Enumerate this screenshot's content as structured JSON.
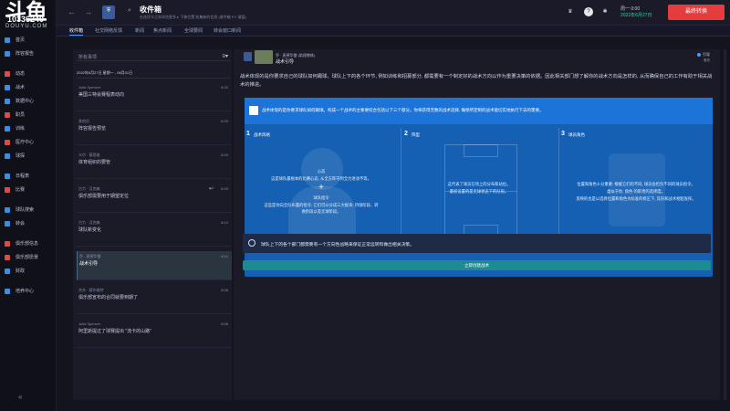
{
  "logo": {
    "mark": "斗鱼",
    "brand": "DOUYU.COM",
    "number": "10336240"
  },
  "sidebar": {
    "items": [
      {
        "label": "首页",
        "color": "#3a8ee6"
      },
      {
        "label": "阵容报告",
        "color": "#3a8ee6"
      },
      {
        "label": "动态",
        "color": "#d94c4c"
      },
      {
        "label": "战术",
        "color": "#3a8ee6"
      },
      {
        "label": "数据中心",
        "color": "#3a8ee6"
      },
      {
        "label": "职员",
        "color": "#d94c4c"
      },
      {
        "label": "训练",
        "color": "#3a8ee6"
      },
      {
        "label": "医疗中心",
        "color": "#d94c4c"
      },
      {
        "label": "球探",
        "color": "#3a8ee6"
      },
      {
        "label": "日程表",
        "color": "#3a8ee6"
      },
      {
        "label": "比赛",
        "color": "#d94c4c"
      },
      {
        "label": "球队搜索",
        "color": "#3a8ee6"
      },
      {
        "label": "转会",
        "color": "#3a8ee6"
      },
      {
        "label": "俱乐部信息",
        "color": "#d94c4c"
      },
      {
        "label": "俱乐部愿景",
        "color": "#d94c4c"
      },
      {
        "label": "财政",
        "color": "#3a8ee6"
      },
      {
        "label": "培养中心",
        "color": "#3a8ee6"
      }
    ],
    "collapse_label": "«"
  },
  "topbar": {
    "back": "←",
    "forward": "→",
    "title": "收件箱",
    "subtitle": "在选项卡之间浏览更多 ▸  下移位置  收集新的信息 (收件箱 PC 键盘)",
    "date_line1": "周一 0:00",
    "date_line2": "2022年6月27日",
    "continue_label": "最终转换"
  },
  "tabs": [
    "收件箱",
    "社交网络反馈",
    "新闻",
    "焦点新闻",
    "全球要闻",
    "转会窗口新闻"
  ],
  "list": {
    "filter_label": "所有事项",
    "filter_icon": "≡▾",
    "period": "2022年6月27日 星期一 - 06月01日",
    "messages": [
      {
        "from": "Julia Spencer",
        "time": "8:20",
        "subject": "美国三特会赛程表动向"
      },
      {
        "from": "其他员",
        "time": "8:20",
        "subject": "阵容报告预览"
      },
      {
        "from": "卡尔 · 基思维",
        "time": "8:20",
        "subject": "体育组织的要管"
      },
      {
        "from": "古力 · 汉克森",
        "time": "8:20",
        "subject": "俱乐部需要用于期望定位"
      },
      {
        "from": "古力 · 汉克森",
        "time": "8:14",
        "subject": "球队新变化"
      },
      {
        "from": "乔 · 麦德华雷",
        "time": "8:14",
        "subject": "战术引导"
      },
      {
        "from": "杰夫 · 赛尔维特",
        "time": "8:08",
        "subject": "俱乐部宣布的合同就要到期了"
      },
      {
        "from": "Julia Spencer",
        "time": "8:08",
        "subject": "阿里斯提过了球赛提出 \"流卡的山路\""
      }
    ]
  },
  "detail": {
    "from": "乔 · 麦德华雷 (助理教练)",
    "subject": "战术引导",
    "toggle_label": "引导",
    "saved_label": "备档",
    "body": "战术体现的是你要求自己的球队如何踢球。球队上下的各个环节, 例如训练和招募部分, 都需要有一个制定好的战术方向以作为重要决策的依据。因此相关部门想了解你的战术方向是怎样的, 从而确保自己的工作有助于相关战术的推进。",
    "banner": "战术体现的是你要求球队如何踢球。构成一个战术的主要要综合包括以下三个部分。你将获得无数的战术选择, 确保所定制的战术能切实地执行下去的需要。",
    "columns": [
      {
        "num": "1",
        "title": "战术风格",
        "text1": "心态",
        "text2": "这是球队最根本的比赛心态, 从全方阵守到全力进攻不等。",
        "plus": "+",
        "text3": "球队指令",
        "text4": "这些是你向全队布置的指令, 它们可以分成三大板块: 持球阶段、转换阶段以及无球阶段。"
      },
      {
        "num": "2",
        "title": "阵型",
        "text1": "这代表了球员在场上的分布和站位。",
        "text2": "最初设置的是无球状态下的队形。"
      },
      {
        "num": "3",
        "title": "球员角色",
        "text1": "位置和角色十分重要; 根据它们的不同, 球员会担负不同的球员指令。",
        "text2": "类似于你, 角色 的职责的选择度。",
        "text3": "反映的也是以选择位置和角色为标准的修正下, 其形和战术相配发挥。"
      }
    ],
    "info": "球队上下的各个部门都需要有一个方向性战略来保证正常运转和做出相关决策。",
    "cta_label": "立即创建战术"
  },
  "colors": {
    "accent": "#1d74d8",
    "panel": "#1b1b27",
    "cta": "#1e8a91",
    "continue": "#e53d3d"
  }
}
